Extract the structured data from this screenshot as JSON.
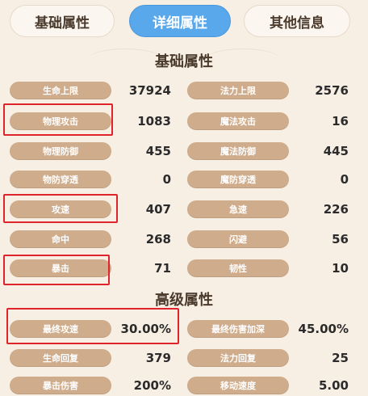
{
  "tabs": [
    {
      "label": "基础属性"
    },
    {
      "label": "详细属性"
    },
    {
      "label": "其他信息"
    }
  ],
  "sections": {
    "basic_title": "基础属性",
    "advanced_title": "高级属性"
  },
  "basic_rows": [
    [
      {
        "label": "生命上限",
        "value": "37924"
      },
      {
        "label": "法力上限",
        "value": "2576"
      }
    ],
    [
      {
        "label": "物理攻击",
        "value": "1083"
      },
      {
        "label": "魔法攻击",
        "value": "16"
      }
    ],
    [
      {
        "label": "物理防御",
        "value": "455"
      },
      {
        "label": "魔法防御",
        "value": "445"
      }
    ],
    [
      {
        "label": "物防穿透",
        "value": "0"
      },
      {
        "label": "魔防穿透",
        "value": "0"
      }
    ],
    [
      {
        "label": "攻速",
        "value": "407"
      },
      {
        "label": "急速",
        "value": "226"
      }
    ],
    [
      {
        "label": "命中",
        "value": "268"
      },
      {
        "label": "闪避",
        "value": "56"
      }
    ],
    [
      {
        "label": "暴击",
        "value": "71"
      },
      {
        "label": "韧性",
        "value": "10"
      }
    ]
  ],
  "advanced_rows": [
    [
      {
        "label": "最终攻速",
        "value": "30.00%"
      },
      {
        "label": "最终伤害加深",
        "value": "45.00%"
      }
    ],
    [
      {
        "label": "生命回复",
        "value": "379"
      },
      {
        "label": "法力回复",
        "value": "25"
      }
    ],
    [
      {
        "label": "暴击伤害",
        "value": "200%"
      },
      {
        "label": "移动速度",
        "value": "5.00"
      }
    ]
  ],
  "colors": {
    "active_tab": "#5aa8ec",
    "label_pill": "#cfac8c",
    "highlight": "#e0242b",
    "background": "#f7efe4"
  }
}
